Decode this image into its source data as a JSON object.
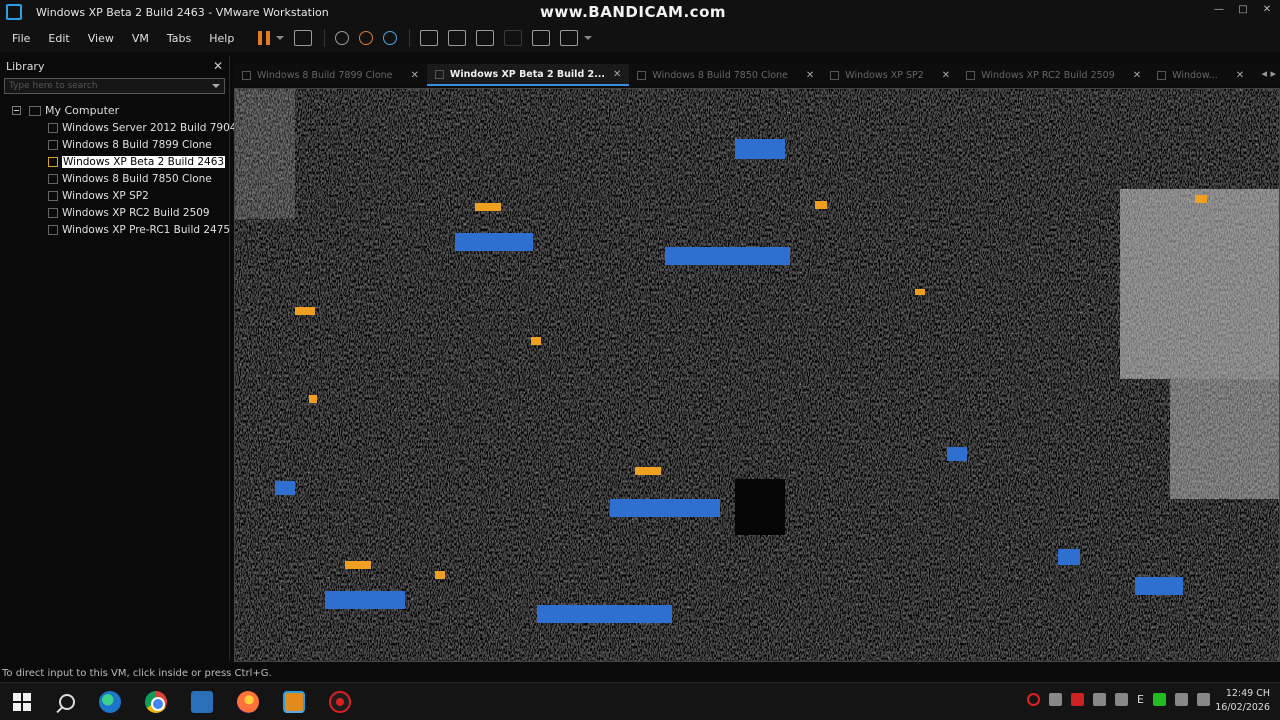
{
  "window": {
    "title": "Windows XP Beta 2 Build 2463 - VMware Workstation",
    "watermark": "www.BANDICAM.com"
  },
  "menu": [
    "File",
    "Edit",
    "View",
    "VM",
    "Tabs",
    "Help"
  ],
  "library": {
    "title": "Library",
    "search_placeholder": "Type here to search",
    "root": "My Computer",
    "items": [
      {
        "label": "Windows Server 2012 Build 7904",
        "selected": false
      },
      {
        "label": "Windows 8 Build 7899 Clone",
        "selected": false
      },
      {
        "label": "Windows XP Beta 2 Build 2463",
        "selected": true
      },
      {
        "label": "Windows 8 Build 7850 Clone",
        "selected": false
      },
      {
        "label": "Windows XP SP2",
        "selected": false
      },
      {
        "label": "Windows XP RC2 Build 2509",
        "selected": false
      },
      {
        "label": "Windows XP Pre-RC1 Build 2475",
        "selected": false
      }
    ]
  },
  "tabs": [
    {
      "label": "Windows 8 Build 7899 Clone",
      "active": false
    },
    {
      "label": "Windows XP Beta 2 Build 2...",
      "active": true
    },
    {
      "label": "Windows 8 Build 7850 Clone",
      "active": false
    },
    {
      "label": "Windows XP SP2",
      "active": false
    },
    {
      "label": "Windows XP RC2 Build 2509",
      "active": false
    },
    {
      "label": "Window...",
      "active": false
    }
  ],
  "status": {
    "text": "To direct input to this VM, click inside or press Ctrl+G."
  },
  "taskbar": {
    "apps": [
      "windows-start",
      "search",
      "edge",
      "chrome",
      "file-explorer",
      "firefox",
      "vmware",
      "bandicam"
    ],
    "tray_ime": "E",
    "time": "12:49 CH",
    "date": "16/02/2026"
  },
  "colors": {
    "accent": "#3a8ee0",
    "pause": "#e67a1e",
    "glitch_blue": "#2f6fd0",
    "glitch_orange": "#f0a020"
  }
}
